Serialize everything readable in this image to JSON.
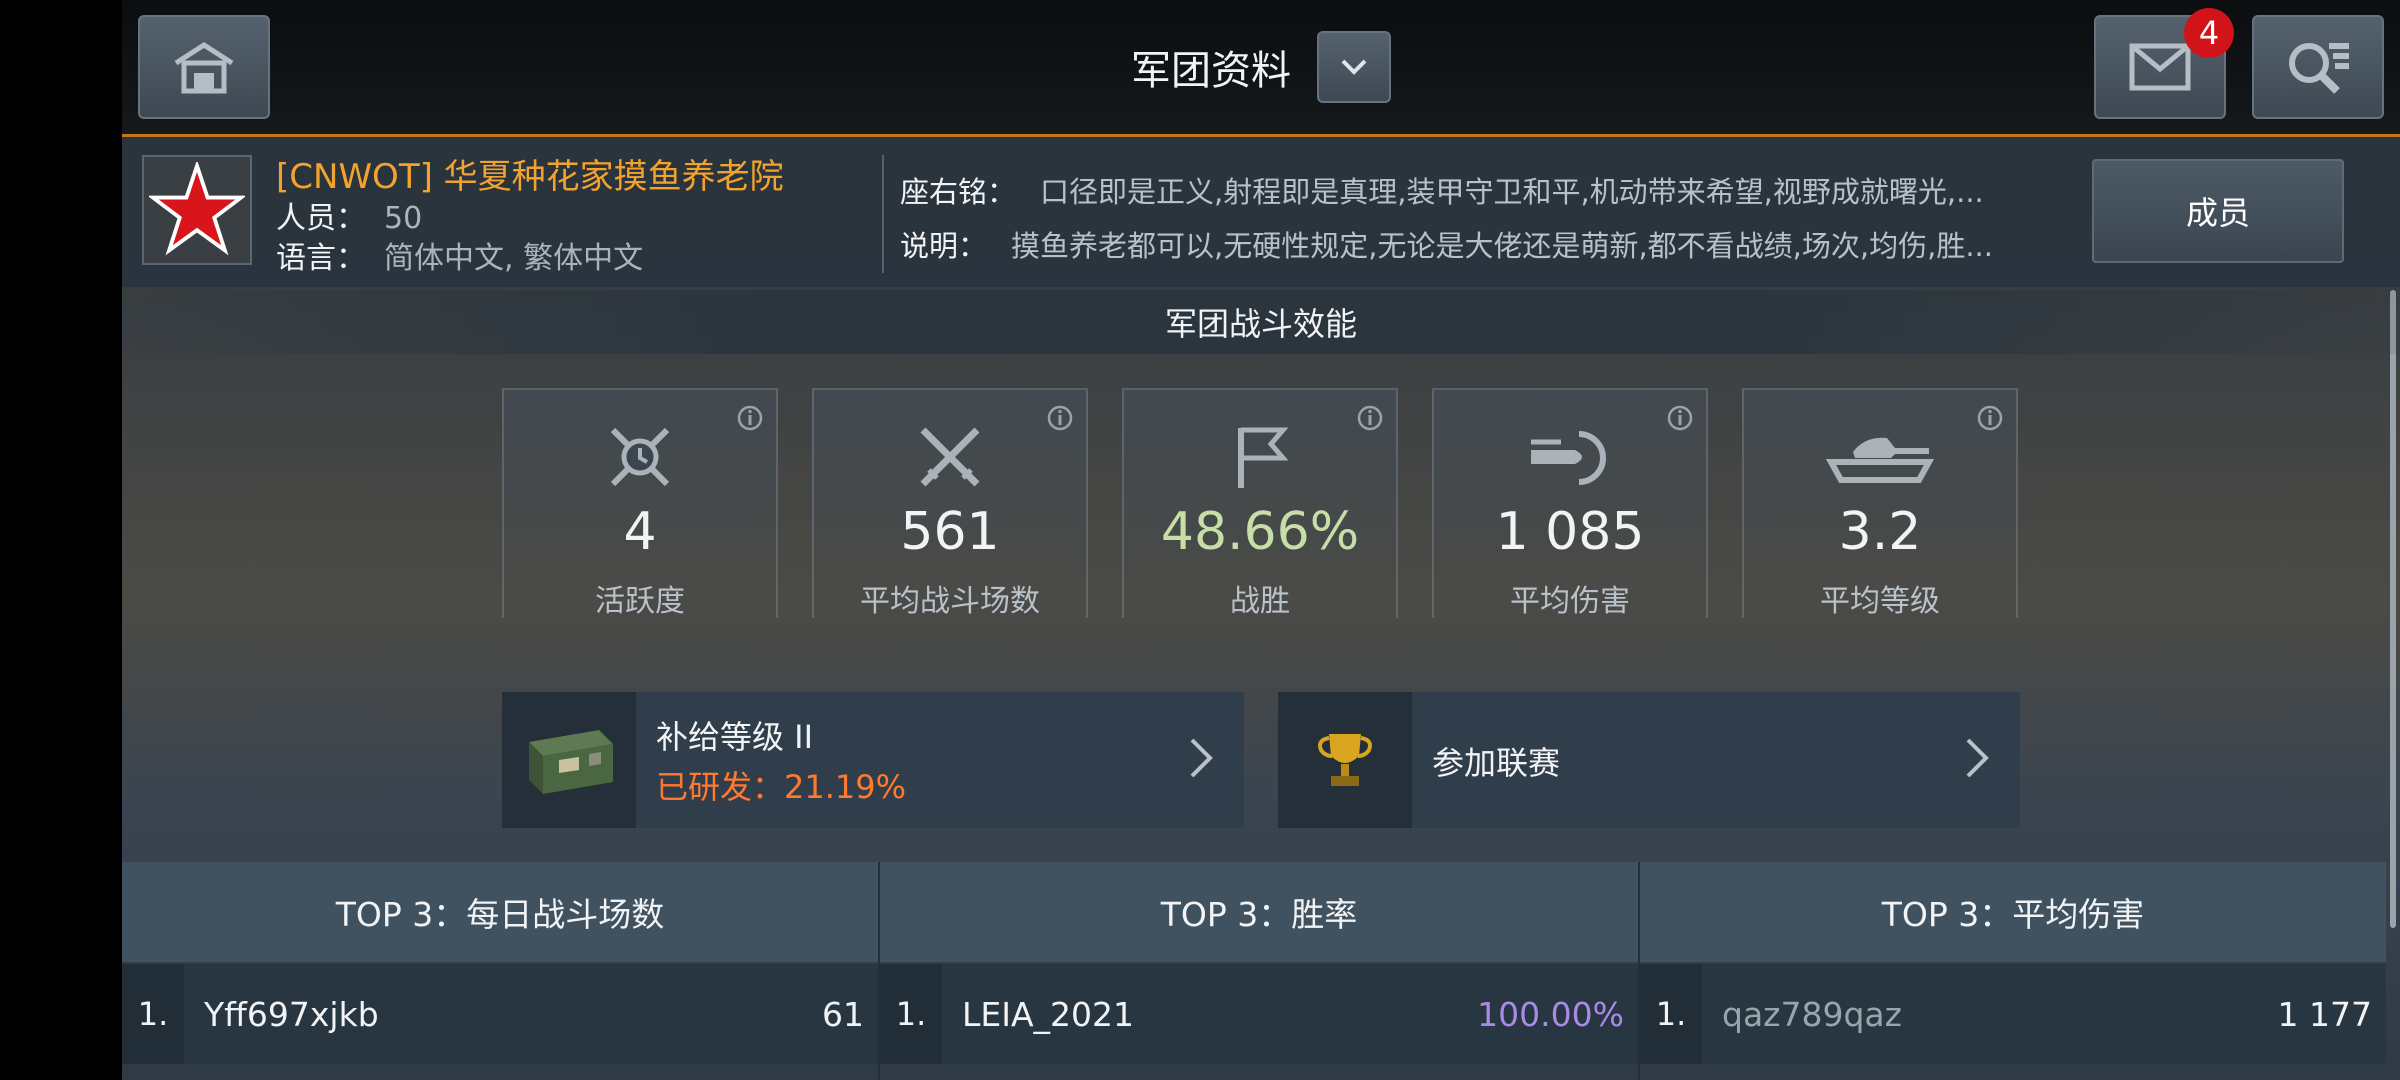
{
  "header": {
    "title": "军团资料",
    "mail_count": "4"
  },
  "clan": {
    "name": "[CNWOT] 华夏种花家摸鱼养老院",
    "members_label": "人员：",
    "members_value": "50",
    "language_label": "语言：",
    "language_value": "简体中文, 繁体中文",
    "motto_label": "座右铭：",
    "motto_value": "口径即是正义,射程即是真理,装甲守卫和平,机动带来希望,视野成就曙光,...",
    "description_label": "说明：",
    "description_value": "摸鱼养老都可以,无硬性规定,无论是大佬还是萌新,都不看战绩,场次,均伤,胜...",
    "members_button": "成员"
  },
  "efficiency": {
    "title": "军团战斗效能",
    "stats": [
      {
        "icon": "activity-swords-clock-icon",
        "value": "4",
        "label": "活跃度",
        "color": "#f1f3f5"
      },
      {
        "icon": "crossed-swords-icon",
        "value": "561",
        "label": "平均战斗场数",
        "color": "#f1f3f5"
      },
      {
        "icon": "flag-icon",
        "value": "48.66%",
        "label": "战胜",
        "color": "#c7dea6"
      },
      {
        "icon": "shell-icon",
        "value": "1 085",
        "label": "平均伤害",
        "color": "#f1f3f5"
      },
      {
        "icon": "tank-icon",
        "value": "3.2",
        "label": "平均等级",
        "color": "#f1f3f5"
      }
    ]
  },
  "supply": {
    "title": "补给等级 II",
    "progress": "已研发：21.19%"
  },
  "league": {
    "title": "参加联赛"
  },
  "top3": [
    {
      "title": "TOP 3：每日战斗场数",
      "rows": [
        {
          "rank": "1.",
          "name": "Yff697xjkb",
          "value": "61",
          "name_color": "#f1f3f5",
          "value_color": "#f1f3f5"
        }
      ]
    },
    {
      "title": "TOP 3：胜率",
      "rows": [
        {
          "rank": "1.",
          "name": "LEIA_2021",
          "value": "100.00%",
          "name_color": "#f1f3f5",
          "value_color": "#a98ae6"
        }
      ]
    },
    {
      "title": "TOP 3：平均伤害",
      "rows": [
        {
          "rank": "1.",
          "name": "qaz789qaz",
          "value": "1 177",
          "name_color": "#9aa4ab",
          "value_color": "#f1f3f5"
        }
      ]
    }
  ]
}
